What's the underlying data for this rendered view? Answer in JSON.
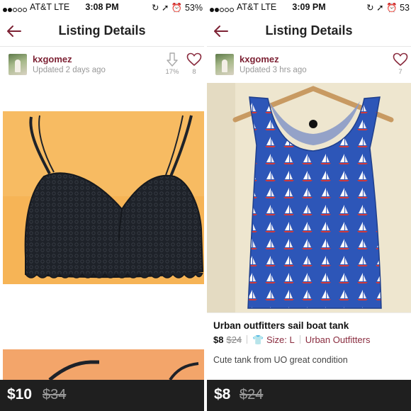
{
  "colors": {
    "accent": "#7d2234",
    "price_bar": "#1f1f1f",
    "tank_blue": "#2d56b8"
  },
  "left": {
    "status": {
      "carrier": "AT&T  LTE",
      "time": "3:08 PM",
      "battery": "53%"
    },
    "header": {
      "title": "Listing Details",
      "back_icon": "back-arrow-icon"
    },
    "seller": {
      "username": "kxgomez",
      "updated": "Updated 2 days ago"
    },
    "price_drop": {
      "icon": "down-arrow-icon",
      "value": "17%"
    },
    "likes": {
      "icon": "heart-icon",
      "count": "8"
    },
    "price_bar": {
      "price": "$10",
      "original": "$34"
    }
  },
  "right": {
    "status": {
      "carrier": "AT&T  LTE",
      "time": "3:09 PM",
      "battery": "53"
    },
    "header": {
      "title": "Listing Details",
      "back_icon": "back-arrow-icon"
    },
    "seller": {
      "username": "kxgomez",
      "updated": "Updated 3 hrs ago"
    },
    "likes": {
      "icon": "heart-icon",
      "count": "7"
    },
    "listing": {
      "title": "Urban outfitters sail boat tank",
      "price": "$8",
      "original_price": "$24",
      "size_icon": "tshirt-icon",
      "size": "Size: L",
      "brand": "Urban Outfitters",
      "description": "Cute tank from UO great condition"
    },
    "price_bar": {
      "price": "$8",
      "original": "$24"
    }
  }
}
